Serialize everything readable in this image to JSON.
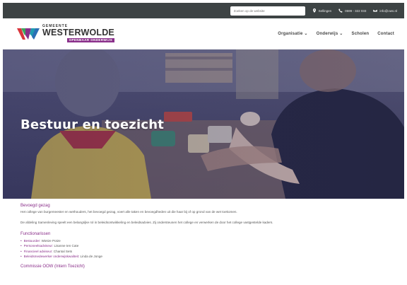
{
  "topbar": {
    "search_placeholder": "Zoeken op de website",
    "location": "Sellingen",
    "phone": "0599 - 322 033",
    "email": "info@ows.nl"
  },
  "brand": {
    "line1": "GEMEENTE",
    "line2": "WESTERWOLDE",
    "line3": "OPENBAAR ONDERWIJS",
    "colors": {
      "purple": "#8a2f8a",
      "red": "#d9353c",
      "green": "#3aa55d",
      "blue": "#2a6fb5",
      "teal": "#1f9bb0"
    }
  },
  "nav": {
    "items": [
      {
        "label": "Organisatie",
        "has_dropdown": true
      },
      {
        "label": "Onderwijs",
        "has_dropdown": true
      },
      {
        "label": "Scholen",
        "has_dropdown": false
      },
      {
        "label": "Contact",
        "has_dropdown": false
      }
    ],
    "caret": "⌄"
  },
  "hero": {
    "title": "Bestuur en toezicht"
  },
  "content": {
    "section1_title": "Bevoegd gezag",
    "section1_p1": "Het college van burgemeester en wethouders, het bevoegd gezag, voert alle taken en bevoegdheden uit die haar bij of op grond van de wet toekomen.",
    "section1_p2": "De afdeling Samenleving speelt een belangrijke rol in beleidsontwikkeling en beleidsadvies. Zij ondersteunen het college en verwerken de door het college vastgestelde kaders.",
    "section2_title": "Functionarissen",
    "functionarissen": [
      {
        "role": "Bestuurder:",
        "name": "Wietze Potze"
      },
      {
        "role": "Personeelsadviseur:",
        "name": "Lisanne ten Cate"
      },
      {
        "role": "Financieel adviseur:",
        "name": "Chantal Sets"
      },
      {
        "role": "Beleidsmedewerker onderwijskwaliteit:",
        "name": "Linda de Jonge"
      }
    ],
    "section3_title": "Commissie OOW (Intern Toezicht)"
  }
}
